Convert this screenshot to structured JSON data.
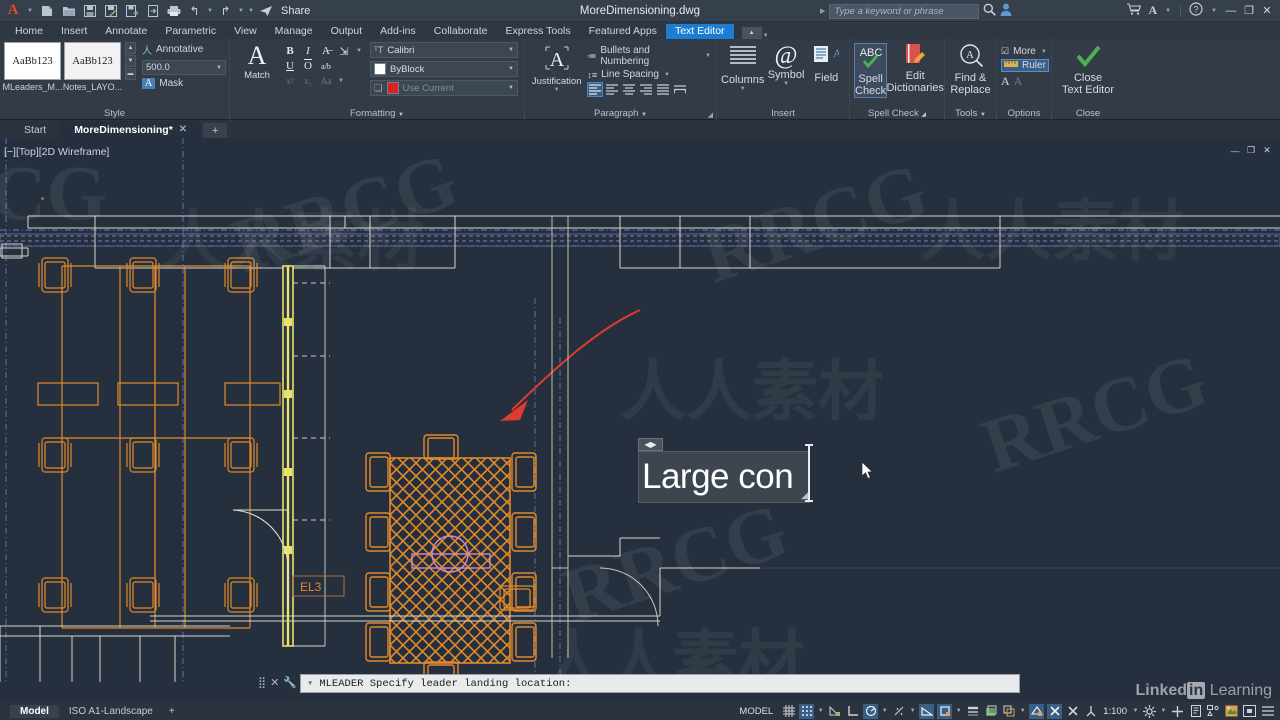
{
  "titlebar": {
    "app_logo": "autocad-A-logo",
    "document_title": "MoreDimensioning.dwg",
    "quick_access": [
      {
        "name": "new-file",
        "glyph": "🗋"
      },
      {
        "name": "open-file",
        "glyph": "🗁"
      },
      {
        "name": "save-file",
        "glyph": "🖫"
      },
      {
        "name": "save-as",
        "glyph": "🖫"
      },
      {
        "name": "save-to-web",
        "glyph": "🖫"
      },
      {
        "name": "open-from-web",
        "glyph": "🗎"
      },
      {
        "name": "plot",
        "glyph": "🖨"
      },
      {
        "name": "undo",
        "glyph": "↰"
      },
      {
        "name": "redo",
        "glyph": "↱"
      }
    ],
    "share_label": "Share",
    "search_placeholder": "Type a keyword or phrase",
    "minimize": "—",
    "restore": "❐",
    "close": "✕"
  },
  "ribbon_tabs": [
    {
      "label": "Home",
      "active": false
    },
    {
      "label": "Insert",
      "active": false
    },
    {
      "label": "Annotate",
      "active": false
    },
    {
      "label": "Parametric",
      "active": false
    },
    {
      "label": "View",
      "active": false
    },
    {
      "label": "Manage",
      "active": false
    },
    {
      "label": "Output",
      "active": false
    },
    {
      "label": "Add-ins",
      "active": false
    },
    {
      "label": "Collaborate",
      "active": false
    },
    {
      "label": "Express Tools",
      "active": false
    },
    {
      "label": "Featured Apps",
      "active": false
    },
    {
      "label": "Text Editor",
      "active": true
    }
  ],
  "panels": {
    "style": {
      "title": "Style",
      "swatches": [
        {
          "sample": "AaBb123",
          "caption": "MLeaders_M..."
        },
        {
          "sample": "AaBb123",
          "caption": "Notes_LAYO..."
        }
      ],
      "annotative_label": "Annotative",
      "height_value": "500.0",
      "mask_label": "Mask"
    },
    "formatting": {
      "title": "Formatting",
      "match_label": "Match",
      "bold": "B",
      "italic": "I",
      "underline": "U",
      "overline": "O",
      "strike": "A̶",
      "stack": "a/b",
      "superscript": "x²",
      "subscript": "x₂",
      "case": "Aa",
      "font_value": "Calibri",
      "color_value": "ByBlock",
      "transparency_value": "Use Current",
      "color_hex": "#ffffff",
      "current_hex": "#e02020"
    },
    "paragraph": {
      "title": "Paragraph",
      "justification_label": "Justification",
      "bullets_label": "Bullets and Numbering",
      "line_spacing_label": "Line Spacing",
      "align_buttons": [
        "align-left-sel",
        "align-left",
        "align-center",
        "align-right",
        "align-justify",
        "align-distribute"
      ]
    },
    "insert": {
      "title": "Insert",
      "items": [
        {
          "label": "Columns",
          "icon": "columns-icon"
        },
        {
          "label": "Symbol",
          "icon": "at-symbol-icon"
        },
        {
          "label": "Field",
          "icon": "field-icon"
        }
      ]
    },
    "spellcheck": {
      "title": "Spell Check",
      "items": [
        {
          "label": "Spell\nCheck",
          "icon": "abc-check-icon",
          "line1": "Spell",
          "line2": "Check"
        },
        {
          "label": "Edit Dictionaries",
          "icon": "dictionary-icon",
          "line1": "Edit",
          "line2": "Dictionaries"
        }
      ]
    },
    "tools": {
      "title": "Tools",
      "items": [
        {
          "line1": "Find &",
          "line2": "Replace",
          "icon": "find-replace-icon"
        }
      ]
    },
    "options": {
      "title": "Options",
      "more_label": "More",
      "ruler_label": "Ruler",
      "charmap_a": "A",
      "charmap_b": "A"
    },
    "close": {
      "title": "Close",
      "line1": "Close",
      "line2": "Text Editor",
      "icon": "green-check-icon"
    }
  },
  "file_tabs": [
    {
      "label": "Start",
      "active": false,
      "closable": false
    },
    {
      "label": "MoreDimensioning*",
      "active": true,
      "closable": true
    }
  ],
  "file_tab_add": "+",
  "viewport": {
    "label": "[−][Top][2D Wireframe]",
    "controls": [
      "minimize",
      "restore",
      "close"
    ]
  },
  "mtext": {
    "value": "Large con",
    "handle_icon": "move-arrows-icon",
    "resize_icon": "resize-handle-icon"
  },
  "drawing": {
    "room_label": "EL3",
    "leader_color": "#e03c2e",
    "furniture_color": "#e08a2a",
    "wall_color": "#d5d7c9",
    "door_color": "#e0dfc8",
    "dim_color": "#7b85c8",
    "highlight_color": "#e8e36a",
    "pink_color": "#d48ac8"
  },
  "command_line": {
    "text": "MLEADER Specify leader landing location:",
    "prompt_marker": "▾",
    "close_icon": "✕",
    "settings_icon": "🔧"
  },
  "statusbar": {
    "layout_tabs": [
      {
        "label": "Model",
        "active": true
      },
      {
        "label": "ISO A1-Landscape",
        "active": false
      }
    ],
    "layout_add": "+",
    "model_label": "MODEL",
    "scale": "1:100",
    "buttons": [
      {
        "name": "grid-display-icon",
        "glyph": "▦",
        "on": false
      },
      {
        "name": "snap-mode-icon",
        "glyph": "⣿",
        "on": true
      },
      {
        "name": "infer-constraints-icon",
        "glyph": "⊿",
        "on": false
      },
      {
        "name": "ortho-mode-icon",
        "glyph": "⌐",
        "on": false
      },
      {
        "name": "polar-tracking-icon",
        "glyph": "◷",
        "on": true
      },
      {
        "name": "isometric-drafting-icon",
        "glyph": "⟋",
        "on": false
      },
      {
        "name": "object-snap-tracking-icon",
        "glyph": "∠",
        "on": true
      },
      {
        "name": "object-snap-icon",
        "glyph": "⊡",
        "on": true
      },
      {
        "name": "lineweight-icon",
        "glyph": "≡",
        "on": false
      },
      {
        "name": "transparency-icon",
        "glyph": "▣",
        "on": false
      },
      {
        "name": "selection-cycling-icon",
        "glyph": "⧉",
        "on": false
      },
      {
        "name": "3d-object-snap-icon",
        "glyph": "⌗",
        "on": true
      },
      {
        "name": "dynamic-ucs-icon",
        "glyph": "✗",
        "on": true
      },
      {
        "name": "selection-filtering-icon",
        "glyph": "✗",
        "on": false
      },
      {
        "name": "gizmo-icon",
        "glyph": "人",
        "on": false
      }
    ],
    "trailing": [
      {
        "name": "annotation-visibility-icon",
        "glyph": "✸"
      },
      {
        "name": "add-scale-icon",
        "glyph": "✛"
      },
      {
        "name": "workspace-switching-icon",
        "glyph": "▤"
      },
      {
        "name": "annotation-monitor-icon",
        "glyph": "⧈"
      },
      {
        "name": "units-icon",
        "glyph": "⬒"
      },
      {
        "name": "isolate-objects-icon",
        "glyph": "⊡"
      },
      {
        "name": "customization-icon",
        "glyph": "☰"
      }
    ]
  },
  "watermarks": {
    "brand": "RRCG",
    "cn_text": "人人素材",
    "linkedin_1": "Linked",
    "linkedin_in": "in",
    "linkedin_2": "Learning"
  }
}
